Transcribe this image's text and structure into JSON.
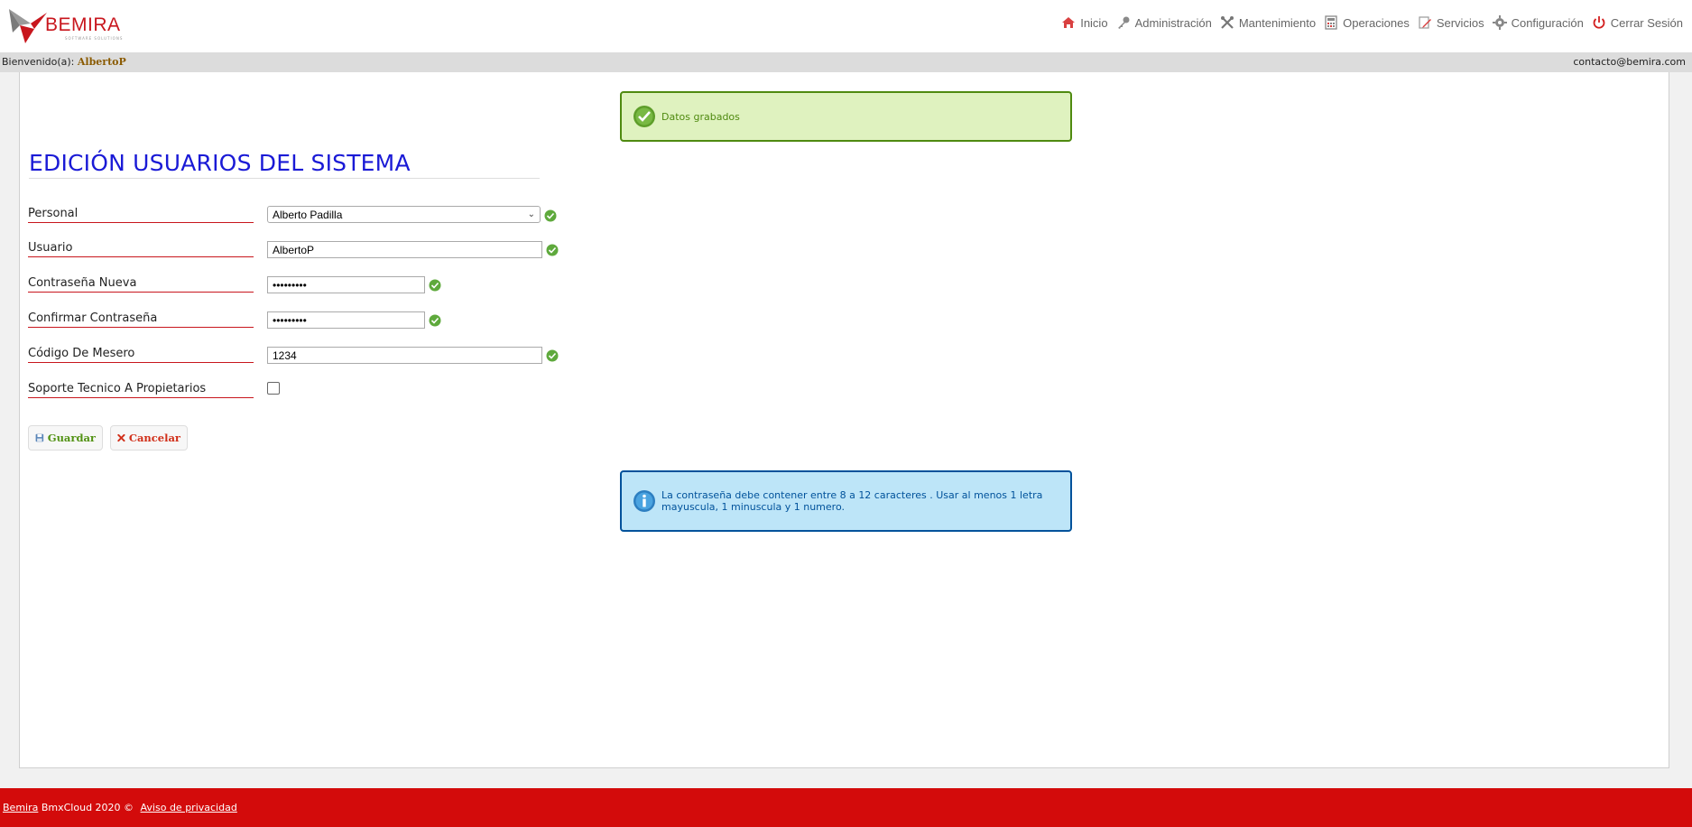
{
  "brand": {
    "logo_text": "BEMIRA",
    "logo_tagline": "SOFTWARE SOLUTIONS"
  },
  "nav": {
    "items": [
      {
        "label": "Inicio",
        "icon": "home-icon"
      },
      {
        "label": "Administración",
        "icon": "key-icon"
      },
      {
        "label": "Mantenimiento",
        "icon": "tools-icon"
      },
      {
        "label": "Operaciones",
        "icon": "calculator-icon"
      },
      {
        "label": "Servicios",
        "icon": "edit-icon"
      },
      {
        "label": "Configuración",
        "icon": "gear-icon"
      },
      {
        "label": "Cerrar Sesión",
        "icon": "power-icon"
      }
    ]
  },
  "welcome": {
    "prefix": "Bienvenido(a):",
    "user": "AlbertoP",
    "contact": "contacto@bemira.com"
  },
  "messages": {
    "success": "Datos grabados",
    "info": "La contraseña debe contener entre 8 a 12 caracteres . Usar al menos 1 letra mayuscula, 1 minuscula y 1 numero."
  },
  "form": {
    "title": "EDICIÓN USUARIOS DEL SISTEMA",
    "personal_label": "Personal",
    "personal_value": "Alberto Padilla",
    "usuario_label": "Usuario",
    "usuario_value": "AlbertoP",
    "pass_label": "Contraseña Nueva",
    "pass_value": "Password1",
    "confirm_label": "Confirmar Contraseña",
    "confirm_value": "Password1",
    "codigo_label": "Código De Mesero",
    "codigo_value": "1234",
    "soporte_label": "Soporte Tecnico A Propietarios",
    "soporte_checked": false,
    "save_label": "Guardar",
    "cancel_label": "Cancelar"
  },
  "footer": {
    "brand_link": "Bemira",
    "text": " BmxCloud 2020 © ",
    "privacy_link": "Aviso de privacidad"
  },
  "colors": {
    "brand_red": "#d30b0b",
    "title_blue": "#1a1ad6",
    "success_green": "#4f8a10",
    "info_blue": "#00529b"
  }
}
